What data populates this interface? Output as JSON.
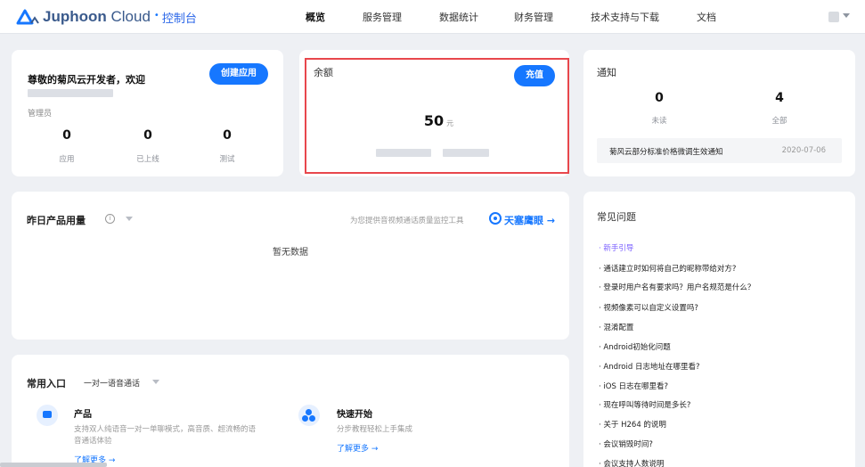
{
  "header": {
    "brand_bold": "Juphoon",
    "brand_rest": " Cloud",
    "brand_dot": "•",
    "console": "控制台",
    "nav": [
      "概览",
      "服务管理",
      "数据统计",
      "财务管理",
      "技术支持与下载",
      "文档"
    ],
    "active_nav": "概览"
  },
  "welcome": {
    "title": "尊敬的菊风云开发者，欢迎",
    "create_button": "创建应用",
    "role": "管理员",
    "stats": [
      {
        "value": "0",
        "label": "应用"
      },
      {
        "value": "0",
        "label": "已上线"
      },
      {
        "value": "0",
        "label": "测试"
      }
    ]
  },
  "balance": {
    "title": "余额",
    "recharge_button": "充值",
    "amount": "50",
    "unit": "元"
  },
  "notice": {
    "title": "通知",
    "unread_count": "0",
    "unread_label": "未读",
    "all_count": "4",
    "all_label": "全部",
    "latest_title": "菊风云部分标准价格微调生效通知",
    "latest_date": "2020-07-06"
  },
  "usage": {
    "title": "昨日产品用量",
    "info_glyph": "i",
    "monitor_text": "为您提供音视频通话质量监控工具",
    "monitor_link": "天塞鹰眼 →",
    "empty_text": "暂无数据"
  },
  "entry": {
    "title": "常用入口",
    "selected_option": "一对一语音通话",
    "items": [
      {
        "title": "产品",
        "desc_line1": "支持双人纯语音一对一单聊模式，高音质、超流畅的语",
        "desc_line2": "音通话体验",
        "link": "了解更多 →"
      },
      {
        "title": "快速开始",
        "desc_line1": "分步教程轻松上手集成",
        "desc_line2": "",
        "link": "了解更多 →"
      }
    ]
  },
  "faq": {
    "title": "常见问题",
    "items": [
      "· 新手引导",
      "· 通话建立时如何将自己的昵称带给对方?",
      "· 登录时用户名有要求吗？用户名规范是什么？",
      "· 视频像素可以自定义设置吗?",
      "· 混淆配置",
      "· Android初始化问题",
      "· Android 日志地址在哪里看?",
      "· iOS 日志在哪里看?",
      "· 现在呼叫等待时间是多长?",
      "· 关于 H264 的说明",
      "· 会议销毁时间?",
      "· 会议支持人数说明"
    ]
  },
  "colors": {
    "primary": "#1677ff",
    "highlight_border": "#e8474c",
    "faq_first": "#7b61ff"
  }
}
